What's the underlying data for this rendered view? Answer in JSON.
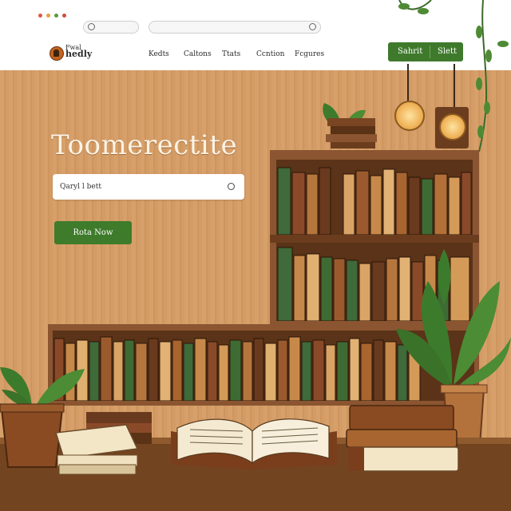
{
  "nav": {
    "logo_line1": "Fwal",
    "logo_line2": "hedly",
    "links": [
      "Kedts",
      "Caltons",
      "Ttats",
      "Ccntion",
      "Fcgures"
    ],
    "submit_label": "Sahrit",
    "submit_label2": "Slett"
  },
  "hero": {
    "title": "Toomerectite",
    "search_value": "Qaryl l bett",
    "cta_label": "Rota Now"
  },
  "colors": {
    "accent": "#3e7b2b",
    "wood": "#d7a06a",
    "shelf": "#8a5530"
  },
  "icons": {
    "url_search": "search-icon",
    "search": "search-icon",
    "logo": "reader-logo-icon"
  }
}
